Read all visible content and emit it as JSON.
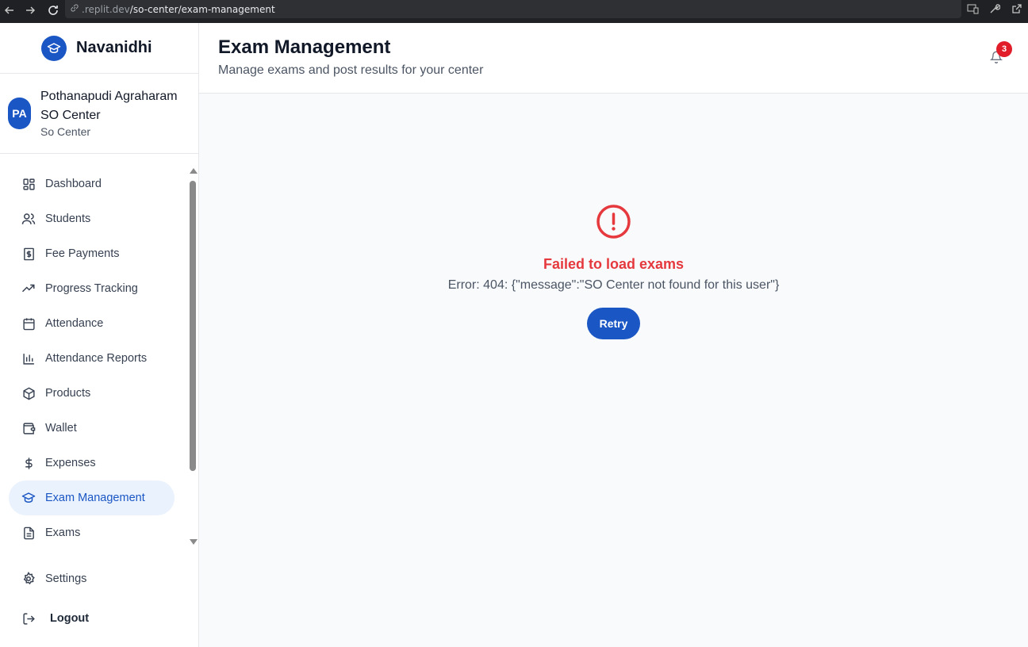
{
  "browser": {
    "url_prefix": ".replit.dev",
    "url_path": "/so-center/exam-management"
  },
  "brand": {
    "name": "Navanidhi"
  },
  "center": {
    "initials": "PA",
    "name": "Pothanapudi Agraharam SO Center",
    "type": "So Center"
  },
  "nav": {
    "items": [
      {
        "label": "Dashboard",
        "icon": "dashboard-icon"
      },
      {
        "label": "Students",
        "icon": "users-icon"
      },
      {
        "label": "Fee Payments",
        "icon": "receipt-dollar-icon"
      },
      {
        "label": "Progress Tracking",
        "icon": "trending-up-icon"
      },
      {
        "label": "Attendance",
        "icon": "calendar-icon"
      },
      {
        "label": "Attendance Reports",
        "icon": "bar-chart-icon"
      },
      {
        "label": "Products",
        "icon": "package-icon"
      },
      {
        "label": "Wallet",
        "icon": "wallet-icon"
      },
      {
        "label": "Expenses",
        "icon": "dollar-icon"
      },
      {
        "label": "Exam Management",
        "icon": "graduation-cap-icon",
        "active": true
      },
      {
        "label": "Exams",
        "icon": "file-text-icon"
      }
    ],
    "settings_label": "Settings",
    "logout_label": "Logout"
  },
  "header": {
    "title": "Exam Management",
    "subtitle": "Manage exams and post results for your center",
    "notification_count": "3"
  },
  "error": {
    "title": "Failed to load exams",
    "message": "Error: 404: {\"message\":\"SO Center not found for this user\"}",
    "retry_label": "Retry"
  },
  "colors": {
    "accent": "#1a56c4",
    "active_bg": "#eaf2fd",
    "error": "#e5393e",
    "badge": "#e11d2a"
  }
}
